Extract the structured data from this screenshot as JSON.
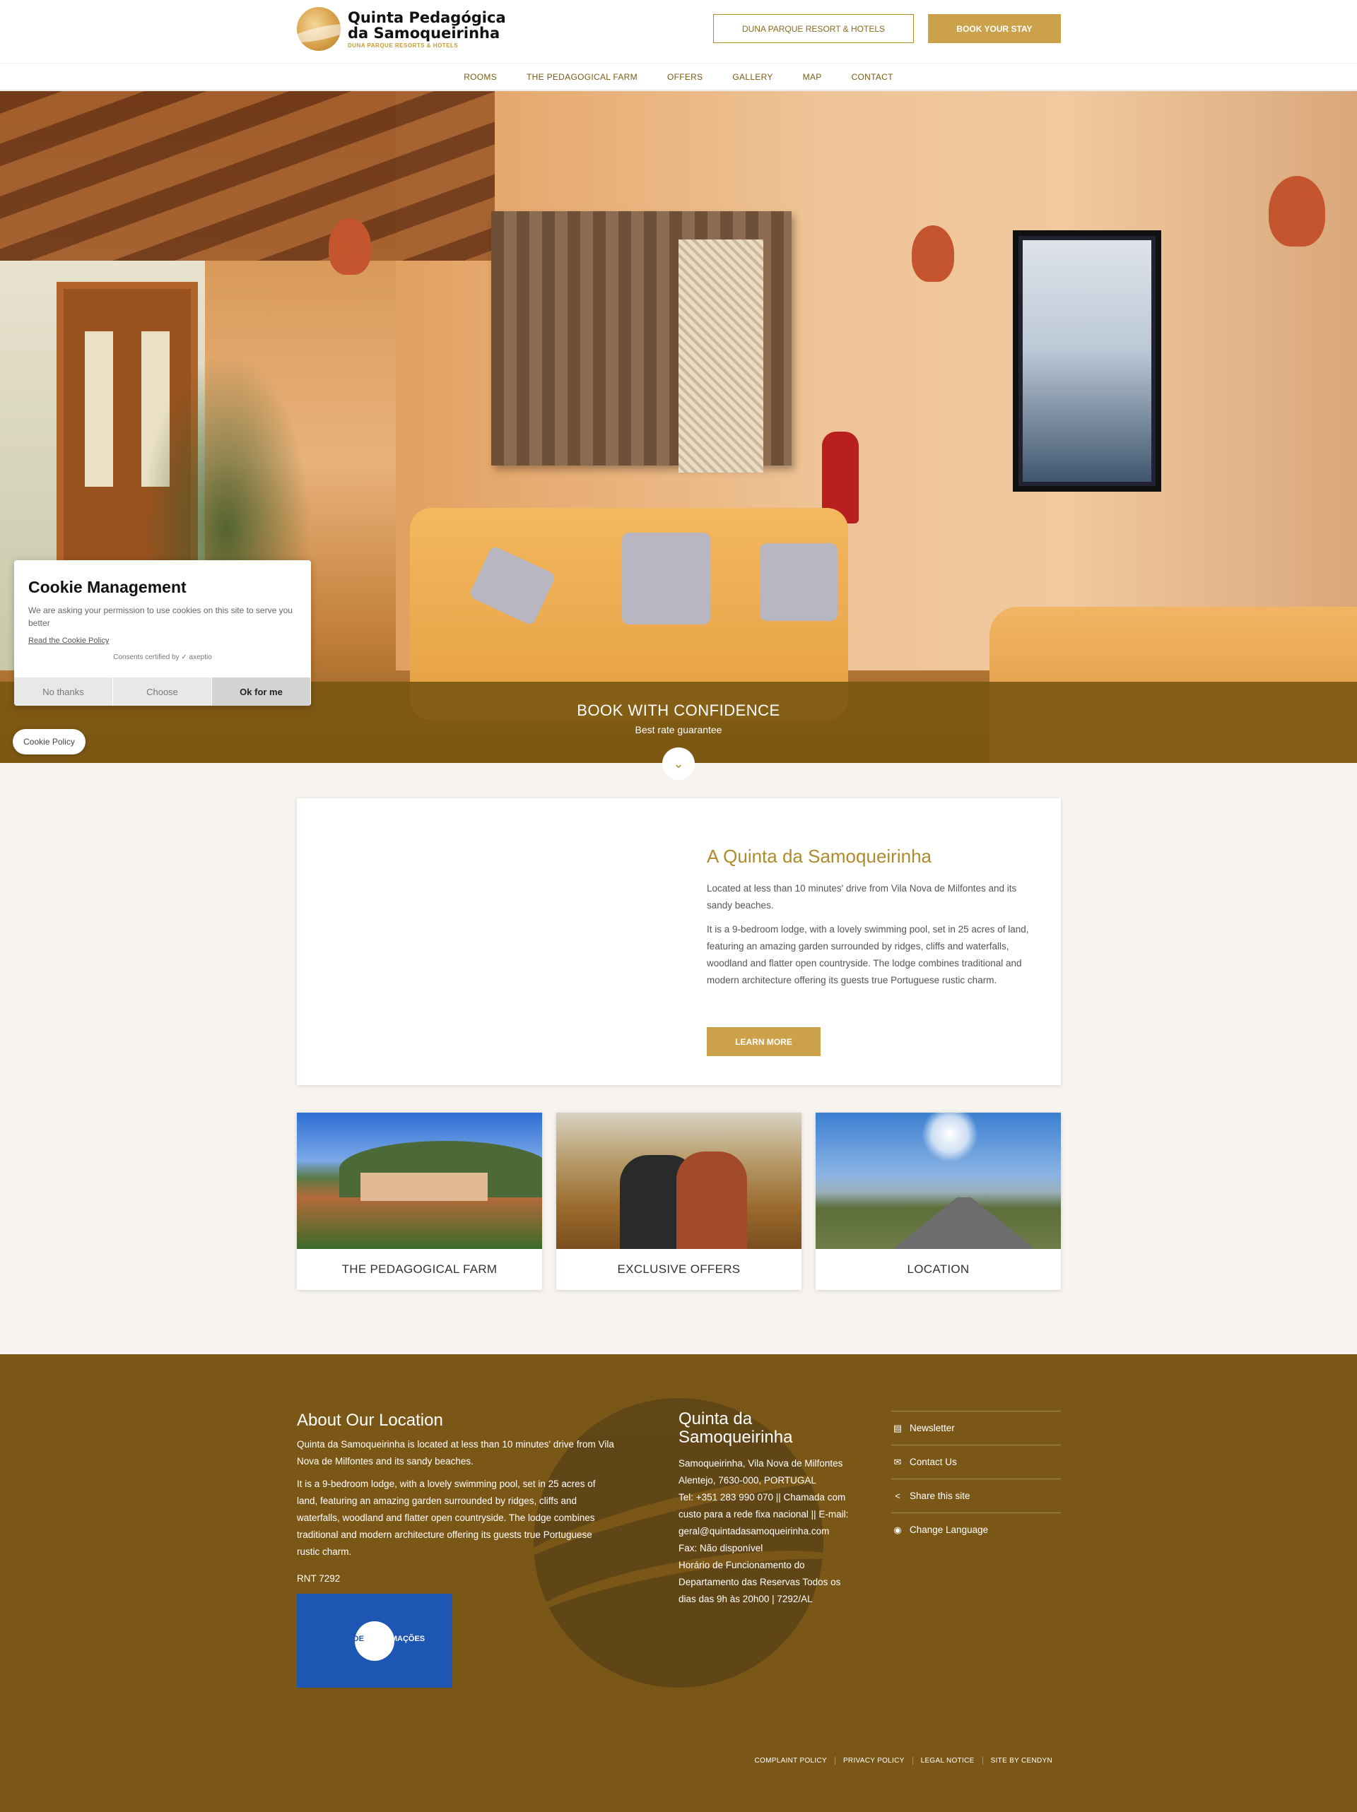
{
  "header": {
    "logo_title": "Quinta Pedagógica da Samoqueirinha",
    "logo_subtitle": "DUNA PARQUE RESORTS & HOTELS",
    "resort_button": "DUNA PARQUE RESORT & HOTELS",
    "book_button": "BOOK YOUR STAY"
  },
  "nav": {
    "items": [
      {
        "label": "ROOMS"
      },
      {
        "label": "THE PEDAGOGICAL FARM"
      },
      {
        "label": "OFFERS"
      },
      {
        "label": "GALLERY"
      },
      {
        "label": "MAP"
      },
      {
        "label": "CONTACT"
      }
    ]
  },
  "hero": {
    "title": "BOOK WITH CONFIDENCE",
    "subtitle": "Best rate guarantee"
  },
  "cookie": {
    "title": "Cookie Management",
    "text": "We are asking your permission to use cookies on this site to serve you better",
    "read_policy": "Read the Cookie Policy",
    "certified": "Consents certified by ✓ axeptio",
    "no_thanks": "No thanks",
    "choose": "Choose",
    "ok": "Ok for me",
    "policy_pill": "Cookie Policy"
  },
  "about": {
    "title": "A Quinta da Samoqueirinha",
    "p1": "Located at less than 10 minutes' drive from Vila Nova de Milfontes and its sandy beaches.",
    "p2": "It is a 9-bedroom lodge, with a lovely swimming pool, set in 25 acres of land, featuring an amazing garden surrounded by ridges, cliffs and waterfalls, woodland and flatter open countryside. The lodge combines traditional and modern architecture offering its guests true Portuguese rustic charm.",
    "learn_more": "LEARN MORE"
  },
  "features": [
    {
      "label": "THE PEDAGOGICAL FARM"
    },
    {
      "label": "EXCLUSIVE OFFERS"
    },
    {
      "label": "LOCATION"
    }
  ],
  "footer": {
    "about_title": "About Our Location",
    "about_p1": "Quinta da Samoqueirinha is located at less than 10 minutes' drive from Vila Nova de Milfontes and its sandy beaches.",
    "about_p2": "It is a 9-bedroom lodge, with a lovely swimming pool, set in 25 acres of land, featuring an amazing garden surrounded by ridges, cliffs and waterfalls, woodland and flatter open countryside. The lodge combines traditional and modern architecture offering its guests true Portuguese rustic charm.",
    "rnt": "RNT 7292",
    "livro_a": "LIVRO DE",
    "livro_b": "RECLAMAÇÕES",
    "contact_title": "Quinta da Samoqueirinha",
    "contact_lines": [
      "Samoqueirinha, Vila Nova de Milfontes",
      "Alentejo, 7630-000, PORTUGAL",
      "Tel: +351 283 990 070 || Chamada com",
      "custo para a rede fixa nacional || E-mail:",
      "geral@quintadasamoqueirinha.com",
      "Fax: Não disponível",
      "Horário de Funcionamento do",
      "Departamento das Reservas Todos os",
      "dias das 9h às 20h00 | 7292/AL"
    ],
    "links": [
      {
        "label": "Newsletter",
        "icon": "newsletter-icon"
      },
      {
        "label": "Contact Us",
        "icon": "envelope-icon"
      },
      {
        "label": "Share this site",
        "icon": "share-icon"
      },
      {
        "label": "Change Language",
        "icon": "globe-icon"
      }
    ],
    "bottom_links": [
      {
        "label": "COMPLAINT POLICY"
      },
      {
        "label": "PRIVACY POLICY"
      },
      {
        "label": "LEGAL NOTICE"
      },
      {
        "label": "SITE BY CENDYN"
      }
    ]
  },
  "colors": {
    "gold": "#cba14a",
    "brown": "#7a5716",
    "accent_text": "#b08b2c"
  }
}
